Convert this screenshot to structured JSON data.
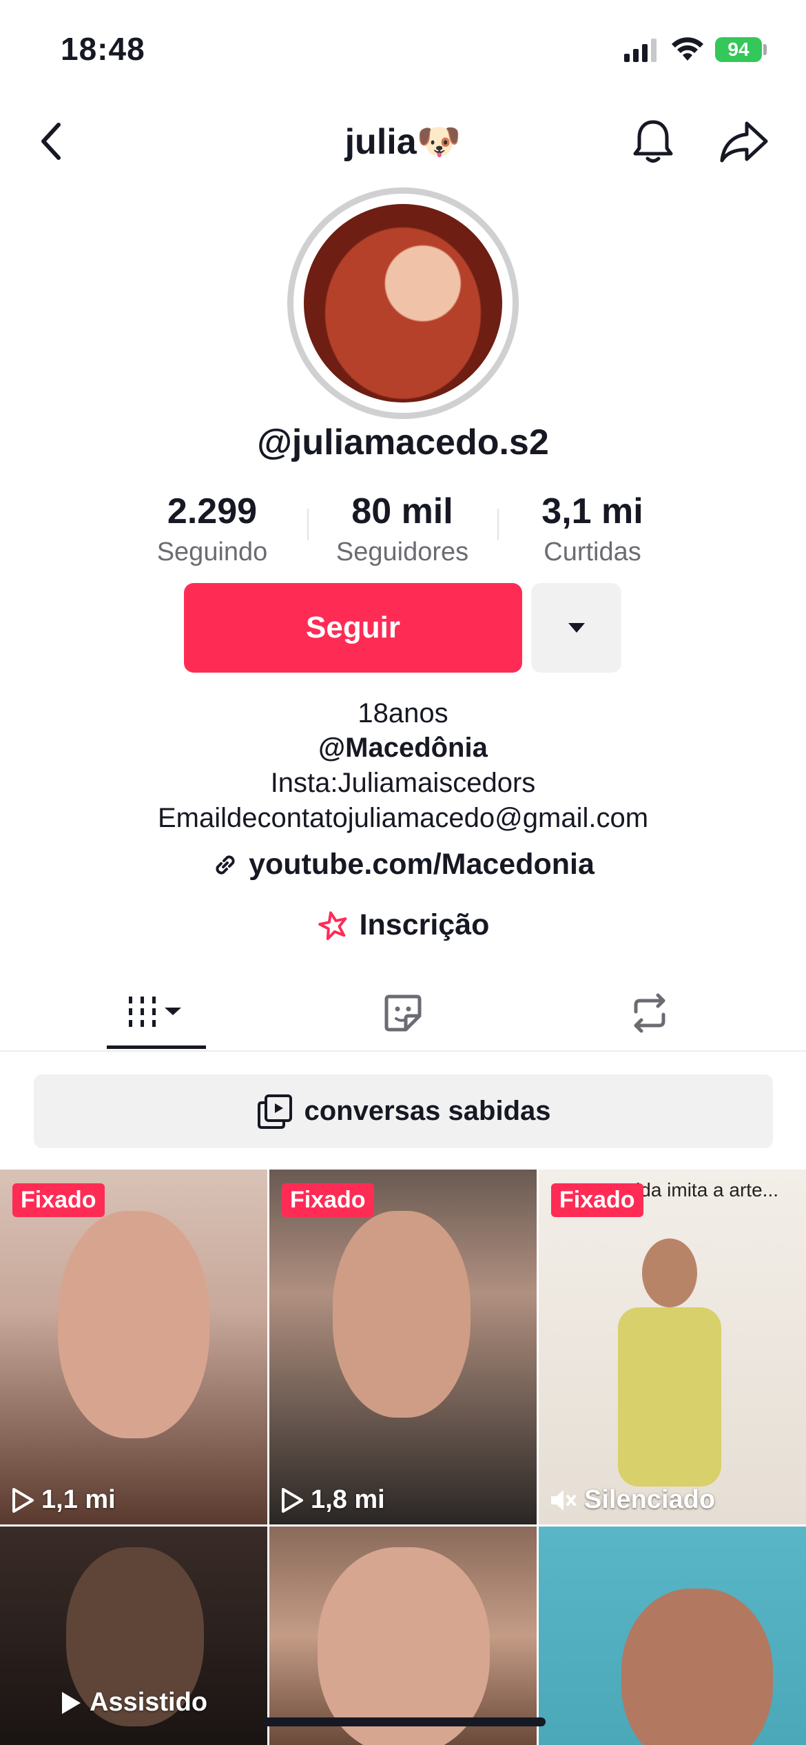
{
  "status_bar": {
    "time": "18:48",
    "battery": "94"
  },
  "header": {
    "title": "julia🐶"
  },
  "profile": {
    "username": "@juliamacedo.s2"
  },
  "stats": [
    {
      "value": "2.299",
      "label": "Seguindo"
    },
    {
      "value": "80 mil",
      "label": "Seguidores"
    },
    {
      "value": "3,1 mi",
      "label": "Curtidas"
    }
  ],
  "actions": {
    "follow_label": "Seguir"
  },
  "bio": {
    "line1": "18anos",
    "line2": "@Macedônia",
    "line3": "Insta:Juliamaiscedors",
    "line4": "Emaildecontatojuliamacedo@gmail.com",
    "link": "youtube.com/Macedonia",
    "subscription": "Inscrição"
  },
  "collection": {
    "label": "conversas sabidas"
  },
  "videos": [
    {
      "badge": "Fixado",
      "stat": "1,1 mi",
      "stat_icon": "play-outline-icon",
      "colors": [
        "#c8a89a",
        "#5a3a2e"
      ]
    },
    {
      "badge": "Fixado",
      "stat": "1,8 mi",
      "stat_icon": "play-outline-icon",
      "colors": [
        "#b09080",
        "#2a2624"
      ]
    },
    {
      "badge": "Fixado",
      "stat": "Silenciado",
      "stat_icon": "muted-icon",
      "caption": "A vida imita a arte...",
      "colors": [
        "#ece6de",
        "#d8d06a"
      ]
    },
    {
      "badge": "",
      "stat": "Assistido",
      "stat_icon": "play-filled-icon",
      "colors": [
        "#3a2c28",
        "#1a1412"
      ]
    },
    {
      "badge": "",
      "stat": "",
      "stat_icon": "",
      "colors": [
        "#c49c86",
        "#6a4a3a"
      ]
    },
    {
      "badge": "",
      "stat": "",
      "stat_icon": "",
      "colors": [
        "#4aa8b8",
        "#b27860"
      ]
    }
  ],
  "colors": {
    "accent": "#fe2c55",
    "text": "#161823",
    "muted": "#6b6b73"
  }
}
